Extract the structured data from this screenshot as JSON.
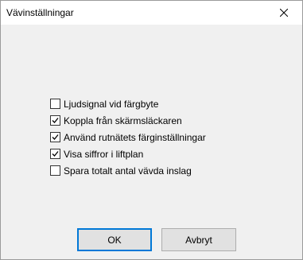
{
  "window": {
    "title": "Vävinställningar",
    "close_icon": "close-icon"
  },
  "options": [
    {
      "label": "Ljudsignal vid färgbyte",
      "checked": false
    },
    {
      "label": "Koppla från skärmsläckaren",
      "checked": true
    },
    {
      "label": "Använd rutnätets färginställningar",
      "checked": true
    },
    {
      "label": "Visa siffror i liftplan",
      "checked": true
    },
    {
      "label": "Spara totalt antal vävda inslag",
      "checked": false
    }
  ],
  "buttons": {
    "ok_label": "OK",
    "cancel_label": "Avbryt"
  },
  "colors": {
    "accent": "#0078d7",
    "dialog_background": "#f0f0f0",
    "titlebar_background": "#ffffff"
  }
}
